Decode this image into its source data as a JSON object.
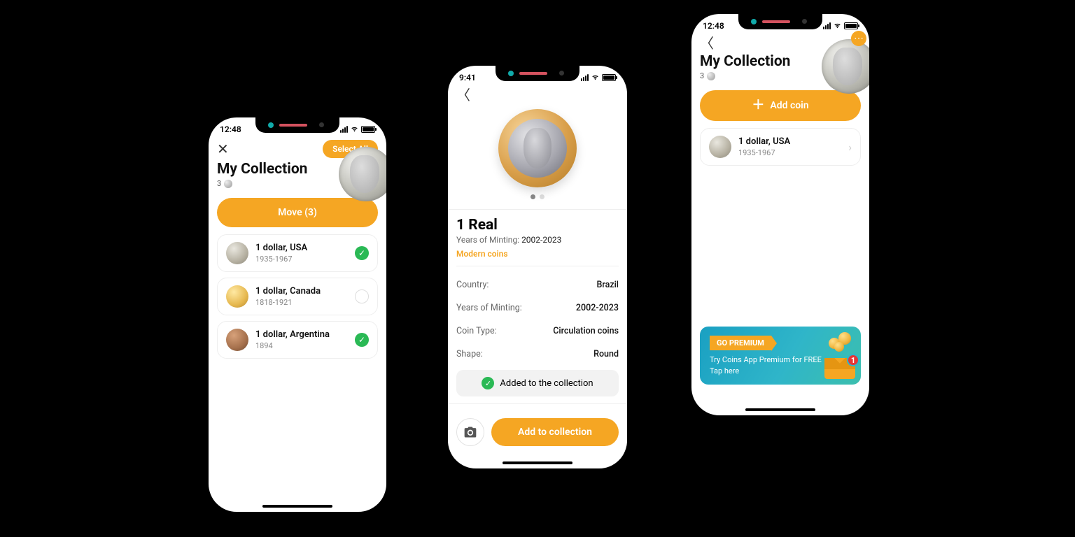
{
  "phone1": {
    "time": "12:48",
    "select_all": "Select All",
    "title": "My Collection",
    "count": "3",
    "move_btn": "Move (3)",
    "items": [
      {
        "title": "1 dollar, USA",
        "sub": "1935-1967",
        "checked": true,
        "thumb": "silver"
      },
      {
        "title": "1 dollar, Canada",
        "sub": "1818-1921",
        "checked": false,
        "thumb": "gold"
      },
      {
        "title": "1 dollar, Argentina",
        "sub": "1894",
        "checked": true,
        "thumb": "bronze"
      }
    ]
  },
  "phone2": {
    "time": "9:41",
    "title": "1 Real",
    "minting_label": "Years of Minting: ",
    "minting_value": "2002-2023",
    "category": "Modern coins",
    "rows": [
      {
        "k": "Country:",
        "v": "Brazil"
      },
      {
        "k": "Years of Minting:",
        "v": "2002-2023"
      },
      {
        "k": "Coin Type:",
        "v": "Circulation coins"
      },
      {
        "k": "Shape:",
        "v": "Round"
      }
    ],
    "added_msg": "Added to the collection",
    "add_btn": "Add to collection"
  },
  "phone3": {
    "time": "12:48",
    "title": "My Collection",
    "count": "3",
    "add_coin": "Add coin",
    "item": {
      "title": "1 dollar, USA",
      "sub": "1935-1967"
    },
    "promo": {
      "badge": "GO PREMIUM",
      "line1": "Try Coins App Premium for FREE",
      "line2": "Tap here",
      "notif": "1"
    }
  }
}
